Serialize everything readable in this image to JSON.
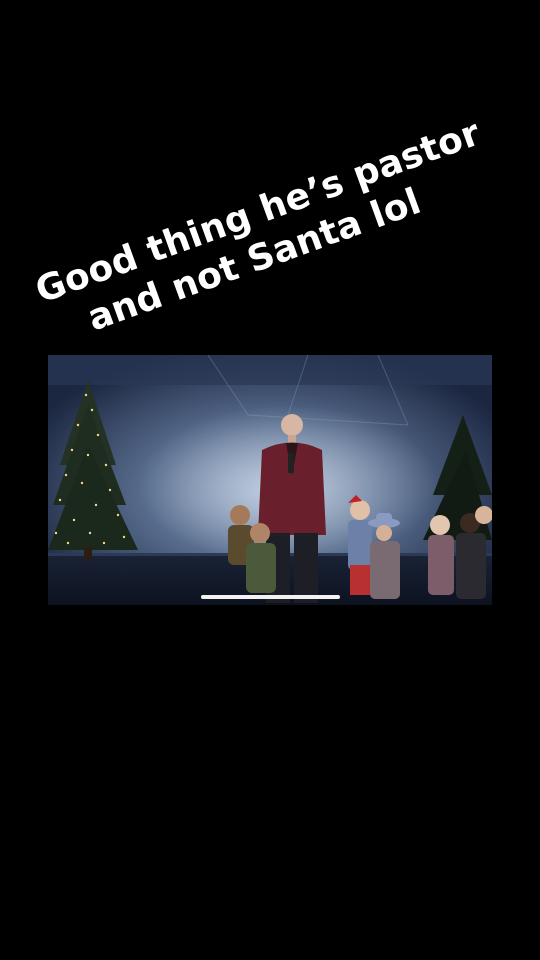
{
  "caption": {
    "lines": [
      "Good thing he’s pastor",
      "and not Santa lol"
    ]
  },
  "video": {
    "logo_icon": "church-logo-icon",
    "playback_progress": 0.0
  },
  "colors": {
    "background": "#000000",
    "caption_text": "#ffffff",
    "stage_backdrop": "#46597a",
    "jacket": "#6a1f2c",
    "scrubber": "#f2f2f2"
  }
}
